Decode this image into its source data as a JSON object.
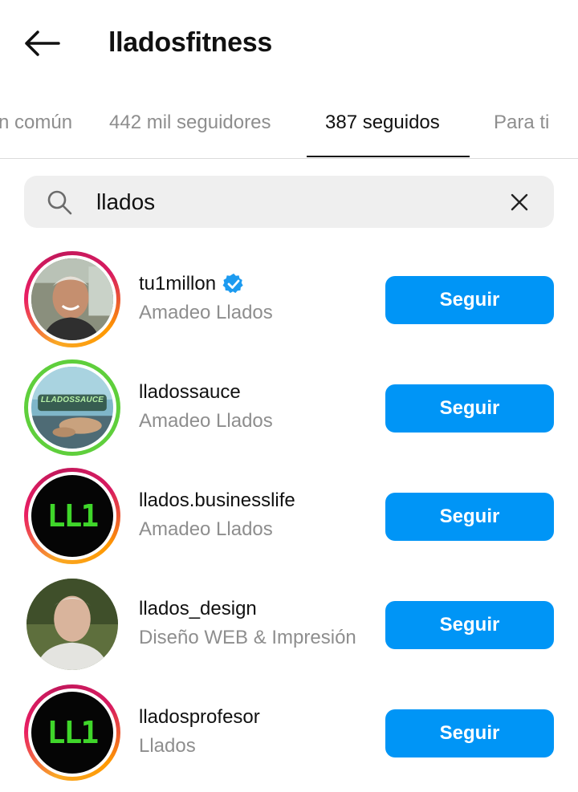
{
  "header": {
    "title": "lladosfitness",
    "back_icon": "arrow-left-icon"
  },
  "tabs": [
    {
      "label": "n común"
    },
    {
      "label": "442 mil seguidores"
    },
    {
      "label": "387 seguidos",
      "active": true
    },
    {
      "label": "Para ti"
    }
  ],
  "search": {
    "value": "llados",
    "icon": "search-icon",
    "clear_icon": "close-icon"
  },
  "accounts": [
    {
      "username": "tu1millon",
      "verified": true,
      "subtitle": "Amadeo Llados",
      "button": "Seguir",
      "ring": "story"
    },
    {
      "username": "lladossauce",
      "verified": false,
      "subtitle": "Amadeo Llados",
      "button": "Seguir",
      "ring": "close-friends",
      "avatar_text": "LLADOSSAUCE"
    },
    {
      "username": "llados.businesslife",
      "verified": false,
      "subtitle": "Amadeo Llados",
      "button": "Seguir",
      "ring": "story",
      "avatar_text": "LL1"
    },
    {
      "username": "llados_design",
      "verified": false,
      "subtitle": "Diseño WEB & Impresión",
      "button": "Seguir",
      "ring": "none"
    },
    {
      "username": "lladosprofesor",
      "verified": false,
      "subtitle": "Llados",
      "button": "Seguir",
      "ring": "story",
      "avatar_text": "LL1"
    }
  ],
  "colors": {
    "accent": "#0095f6",
    "verified": "#1d9bf0",
    "secondary_text": "#8e8e8e",
    "logo_green": "#3fd62a"
  }
}
